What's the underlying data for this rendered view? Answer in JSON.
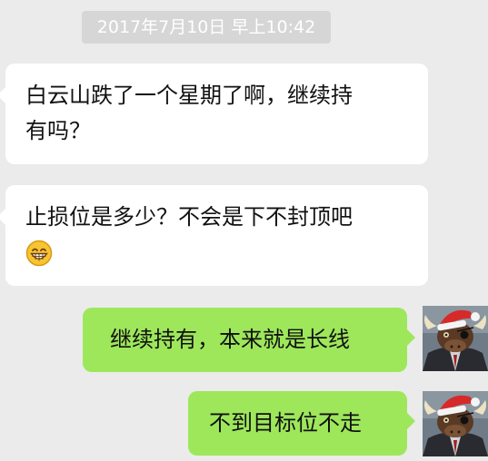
{
  "chat": {
    "timestamp": "2017年7月10日 早上10:42",
    "messages": [
      {
        "sender": "other",
        "lines": [
          "白云山跌了一个星期了啊，继续持",
          "有吗？"
        ]
      },
      {
        "sender": "other",
        "lines": [
          "止损位是多少？不会是下不封顶吧"
        ],
        "emoji": "grinning-face-emoji"
      },
      {
        "sender": "self",
        "text": "继续持有，本来就是长线"
      },
      {
        "sender": "self",
        "text": "不到目标位不走"
      }
    ]
  },
  "colors": {
    "background": "#ebebeb",
    "incoming_bubble": "#ffffff",
    "outgoing_bubble": "#9ee75b",
    "timestamp_bg": "#d6d6d6",
    "timestamp_text": "#ffffff",
    "text": "#111111"
  },
  "icons": {
    "avatar": "bull-with-santa-hat-avatar",
    "emoji": "grinning-face-emoji"
  }
}
